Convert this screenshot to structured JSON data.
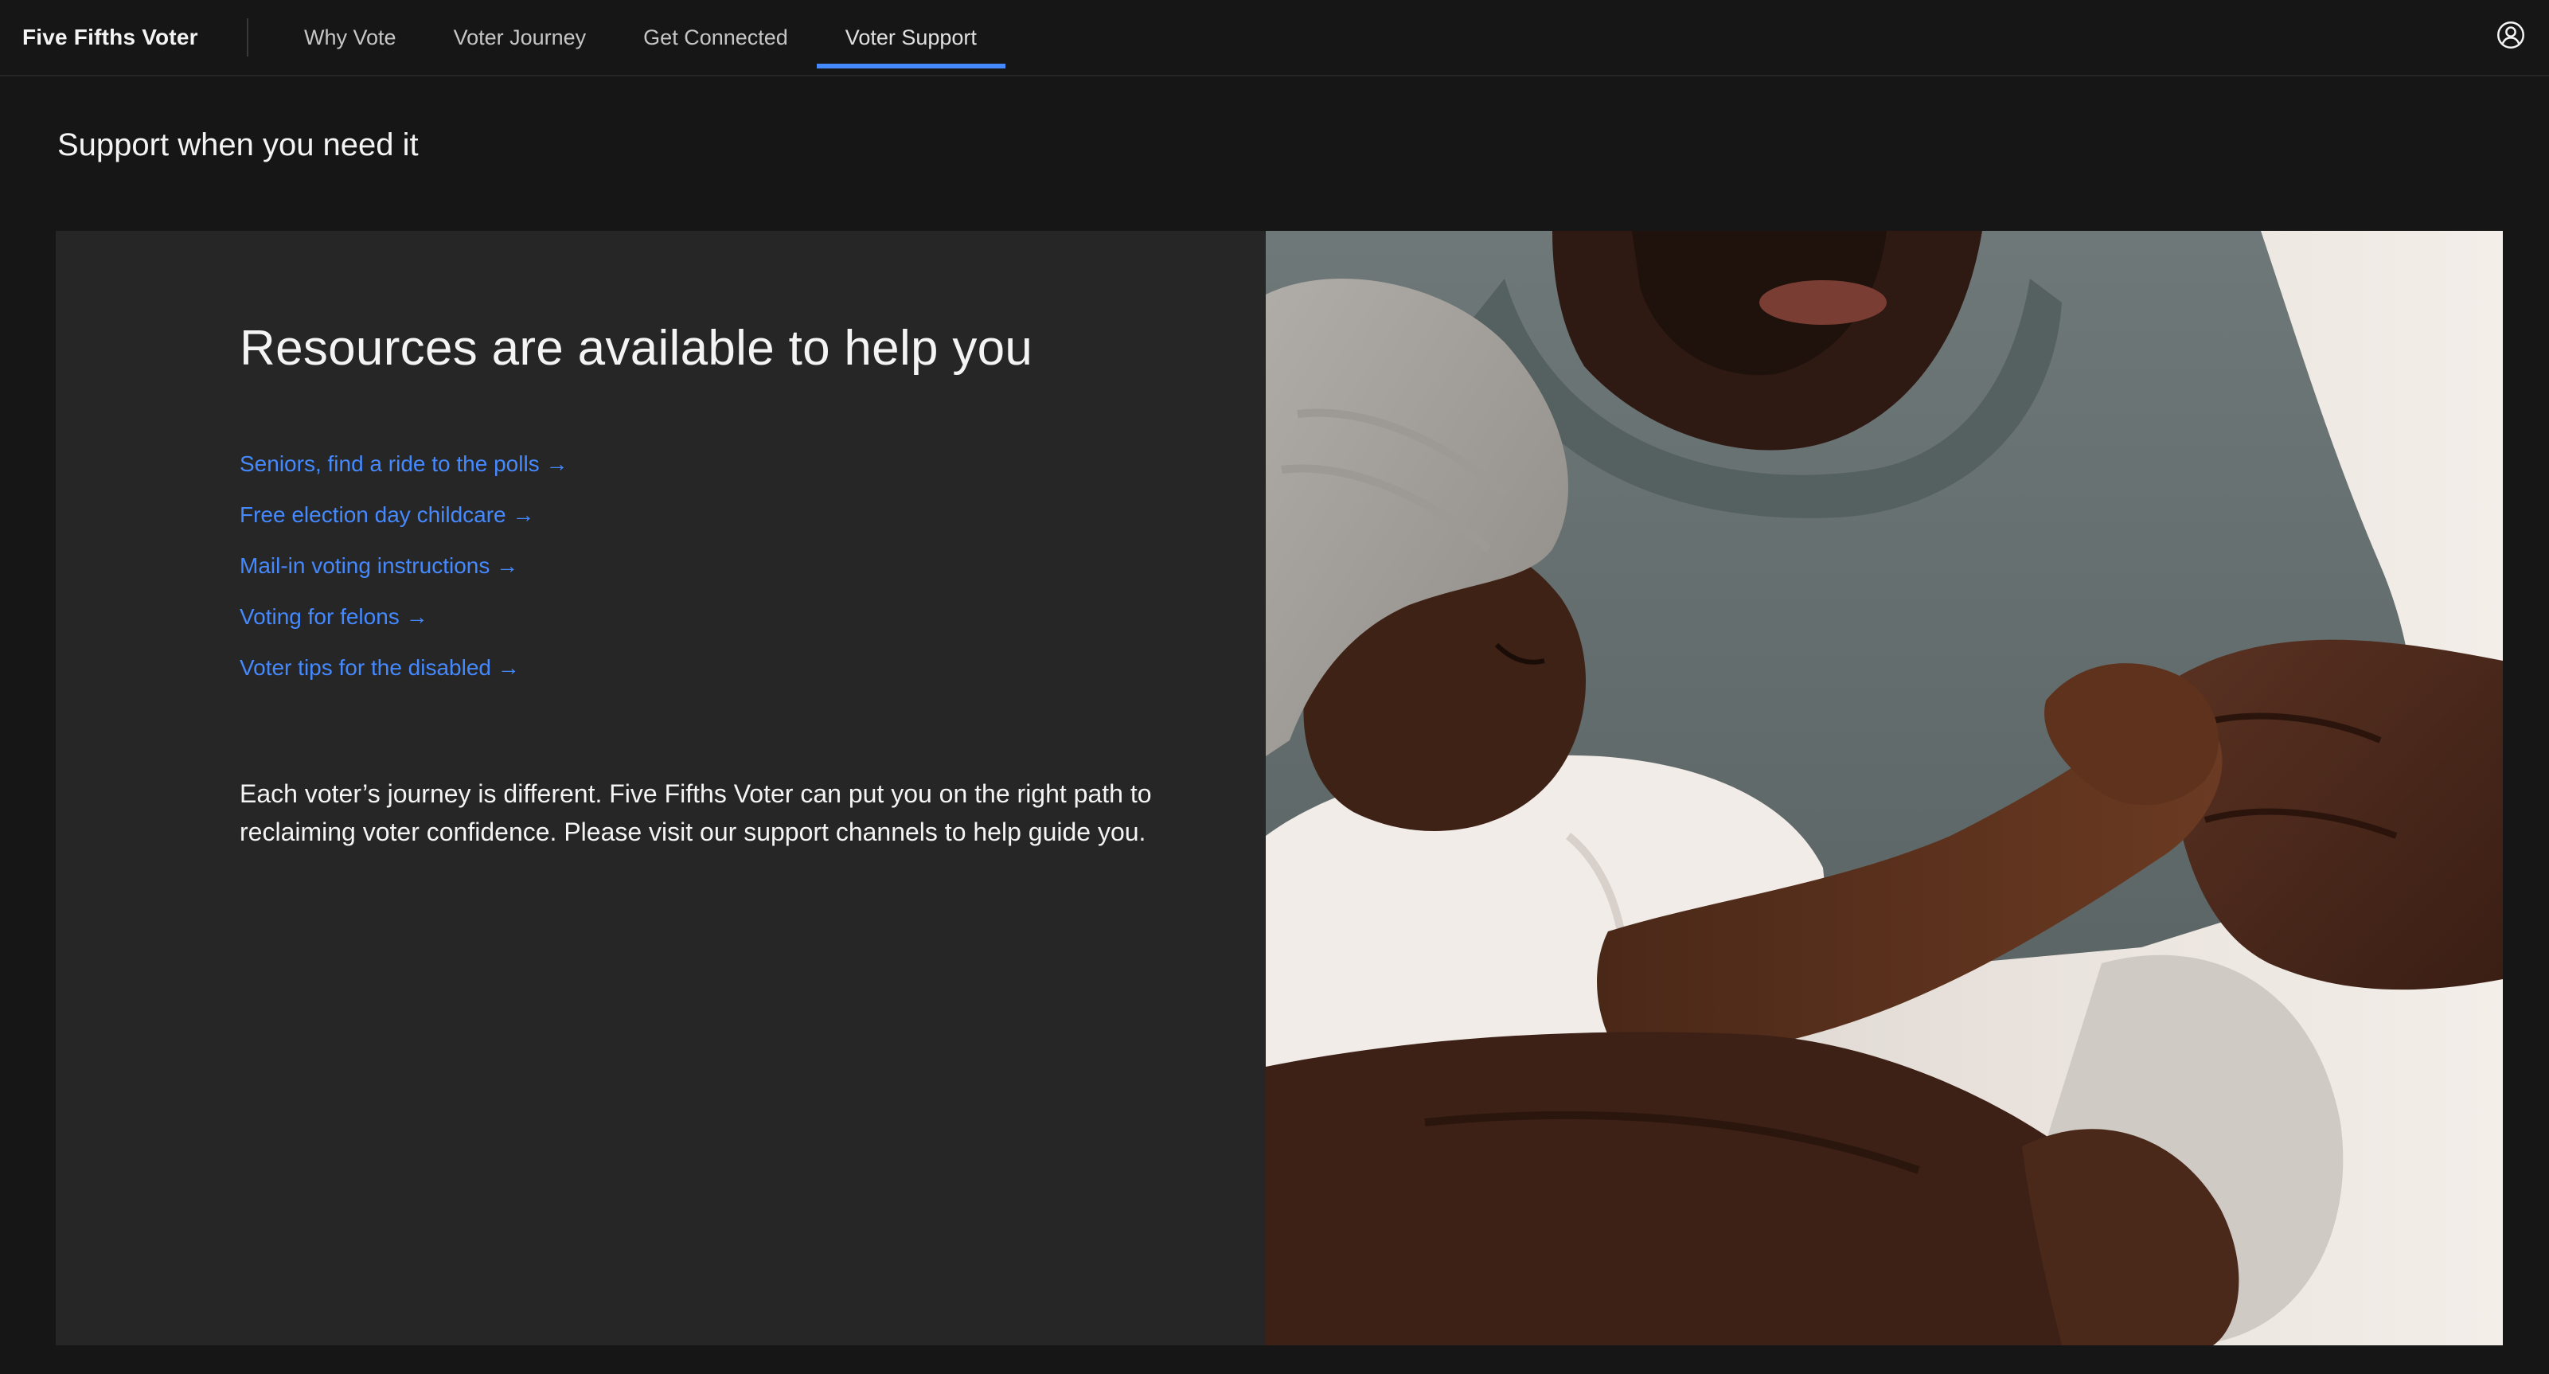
{
  "header": {
    "brand": "Five Fifths Voter",
    "nav": [
      {
        "label": "Why Vote",
        "active": false
      },
      {
        "label": "Voter Journey",
        "active": false
      },
      {
        "label": "Get Connected",
        "active": false
      },
      {
        "label": "Voter Support",
        "active": true
      }
    ],
    "user_icon": "user-avatar-icon"
  },
  "page": {
    "title": "Support when you need it"
  },
  "resources": {
    "heading": "Resources are available to help you",
    "links": [
      {
        "label": "Seniors, find a ride to the polls →"
      },
      {
        "label": "Free election day childcare →"
      },
      {
        "label": "Mail-in voting instructions →"
      },
      {
        "label": "Voting for felons →"
      },
      {
        "label": "Voter tips for the disabled →"
      }
    ],
    "description": "Each voter’s journey is different. Five Fifths Voter can put you on the right path to reclaiming voter confidence. Please visit our support channels to help guide you."
  },
  "image": {
    "subject": "father-holding-baby-photo"
  },
  "colors": {
    "background": "#161616",
    "panel": "#262626",
    "link": "#4589ff",
    "active_tab": "#4589ff"
  }
}
